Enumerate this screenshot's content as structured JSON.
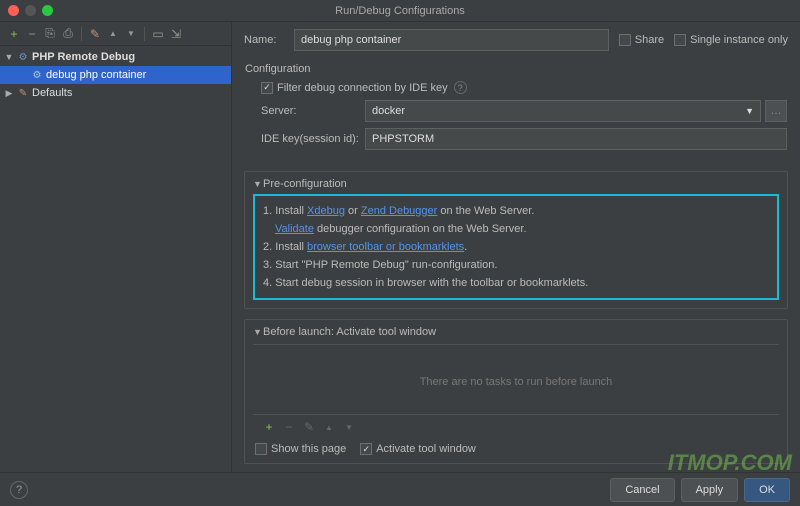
{
  "window": {
    "title": "Run/Debug Configurations"
  },
  "toolbar": {
    "add": "+",
    "remove": "−",
    "copy": "⎘",
    "save": "⎙",
    "wrench": "✎",
    "up": "▲",
    "down": "▼",
    "folder": "▭",
    "collapse": "⇲"
  },
  "tree": {
    "root_label": "PHP Remote Debug",
    "selected_label": "debug php container",
    "defaults_label": "Defaults"
  },
  "form": {
    "name_label": "Name:",
    "name_value": "debug php container",
    "share_label": "Share",
    "single_label": "Single instance only",
    "config_header": "Configuration",
    "filter_label": "Filter debug connection by IDE key",
    "server_label": "Server:",
    "server_value": "docker",
    "idekey_label": "IDE key(session id):",
    "idekey_value": "PHPSTORM"
  },
  "precfg": {
    "header": "Pre-configuration",
    "l1a": "1. Install ",
    "l1_link1": "Xdebug",
    "l1b": " or ",
    "l1_link2": "Zend Debugger",
    "l1c": " on the Web Server.",
    "l2_link": "Validate",
    "l2": " debugger configuration on the Web Server.",
    "l3a": "2. Install ",
    "l3_link": "browser toolbar or bookmarklets",
    "l3b": ".",
    "l4": "3. Start \"PHP Remote Debug\" run-configuration.",
    "l5": "4. Start debug session in browser with the toolbar or bookmarklets."
  },
  "beforelaunch": {
    "header": "Before launch: Activate tool window",
    "empty": "There are no tasks to run before launch",
    "add": "+",
    "remove": "−",
    "edit": "✎",
    "up": "▲",
    "down": "▼",
    "show_label": "Show this page",
    "activate_label": "Activate tool window"
  },
  "footer": {
    "cancel": "Cancel",
    "apply": "Apply",
    "ok": "OK"
  },
  "watermark": "ITMOP.COM"
}
